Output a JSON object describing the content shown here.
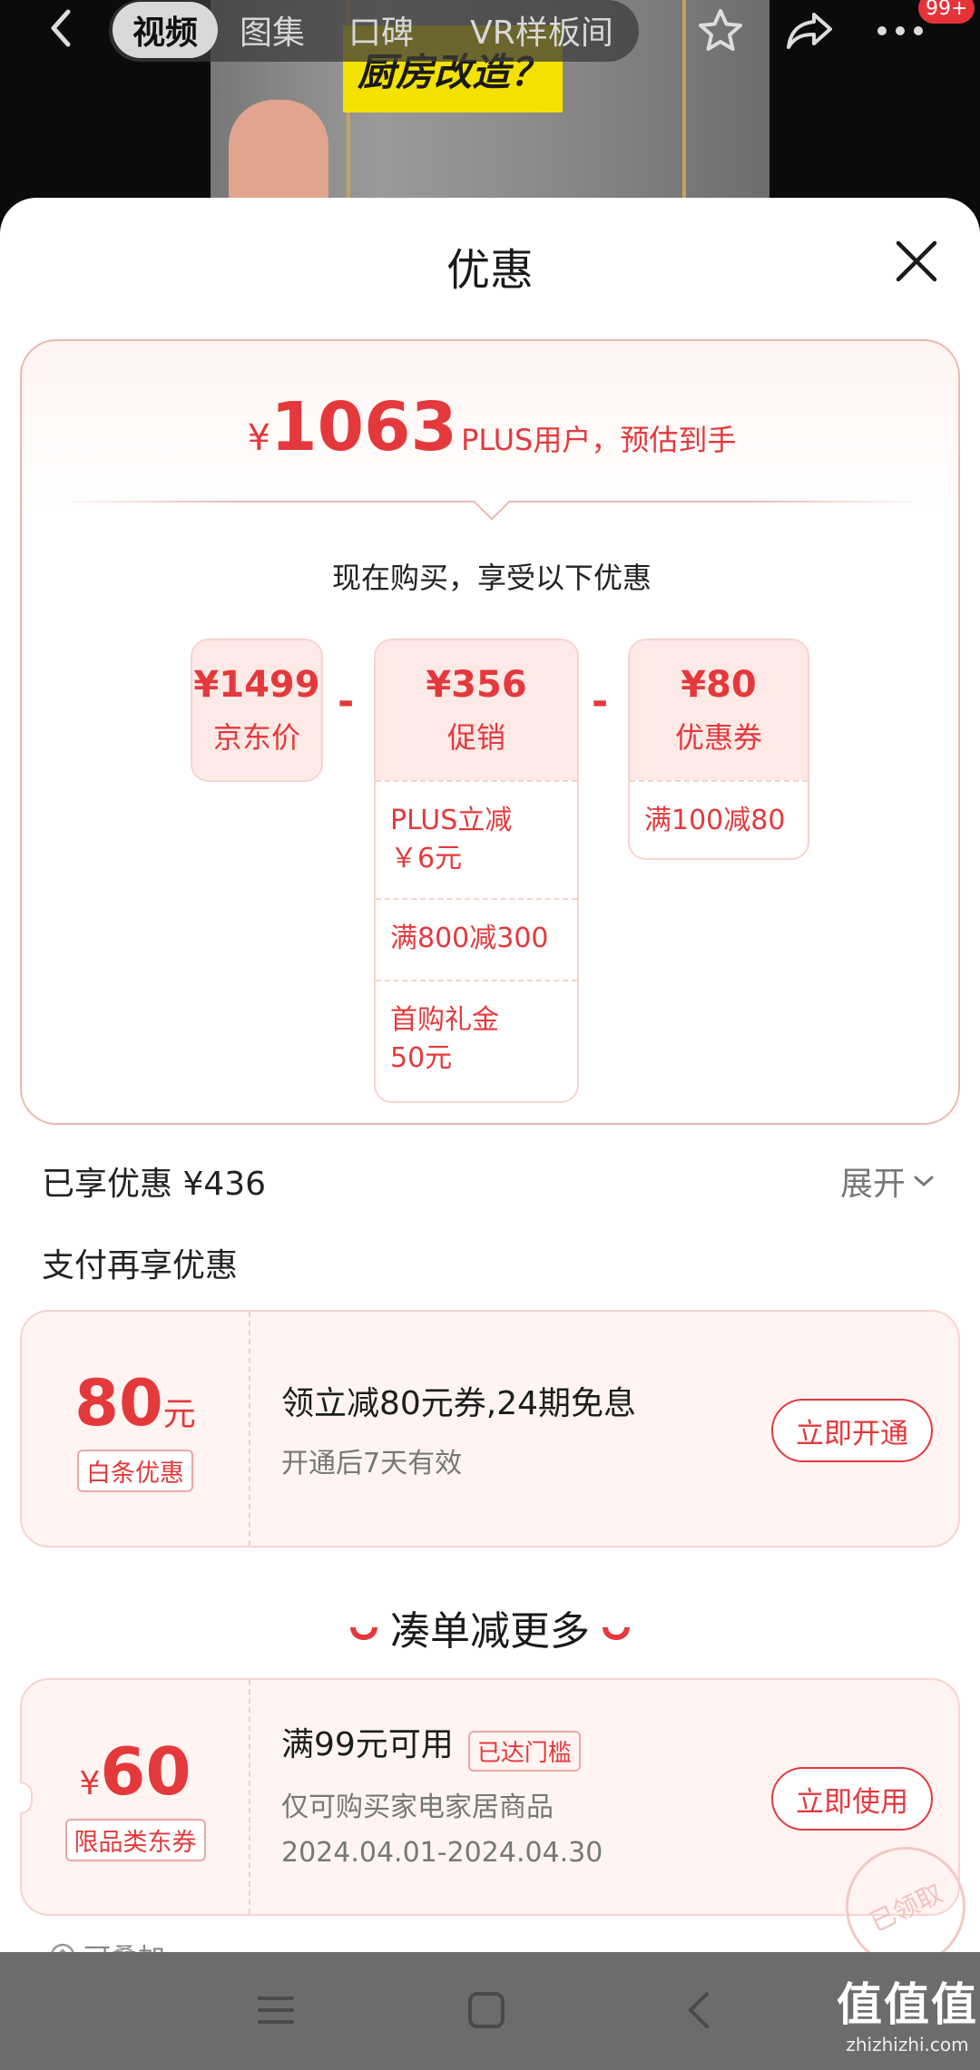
{
  "topbar": {
    "tabs": [
      {
        "label": "视频",
        "active": true
      },
      {
        "label": "图集",
        "active": false
      },
      {
        "label": "口碑",
        "active": false
      },
      {
        "label": "VR样板间",
        "active": false
      }
    ],
    "badge": "99+",
    "icons": [
      "back-icon",
      "star-icon",
      "share-icon",
      "more-icon"
    ]
  },
  "video": {
    "caption": "厨房改造？"
  },
  "sheet": {
    "title": "优惠",
    "final": {
      "currency": "¥",
      "price": "1063",
      "desc": "PLUS用户，预估到手"
    },
    "buy_now": "现在购买，享受以下优惠",
    "breakdown": {
      "jd_price": {
        "amount": "¥1499",
        "label": "京东价"
      },
      "minus": "-",
      "promo": {
        "amount": "¥356",
        "label": "促销",
        "items": [
          "PLUS立减\n￥6元",
          "满800减300",
          "首购礼金\n50元"
        ]
      },
      "coupon": {
        "amount": "¥80",
        "label": "优惠券",
        "items": [
          "满100减80"
        ]
      }
    },
    "enjoyed": "已享优惠 ¥436",
    "expand": "展开",
    "pay_title": "支付再享优惠",
    "baitiao": {
      "value": "80",
      "unit": "元",
      "tag": "白条优惠",
      "title": "领立减80元券,24期免息",
      "sub": "开通后7天有效",
      "action": "立即开通"
    },
    "more_title": "凑单减更多",
    "coupon60": {
      "currency": "¥",
      "value": "60",
      "tag": "限品类东券",
      "title": "满99元可用",
      "reached": "已达门槛",
      "sub": "仅可购买家电家居商品",
      "date": "2024.04.01-2024.04.30",
      "action": "立即使用",
      "stamp": "已领取"
    },
    "stackable": "可叠加"
  },
  "watermark": {
    "big": "值值值",
    "small": "zhizhizhi.com"
  },
  "colors": {
    "accent": "#e4393c",
    "light_bg": "#fde9e6"
  }
}
